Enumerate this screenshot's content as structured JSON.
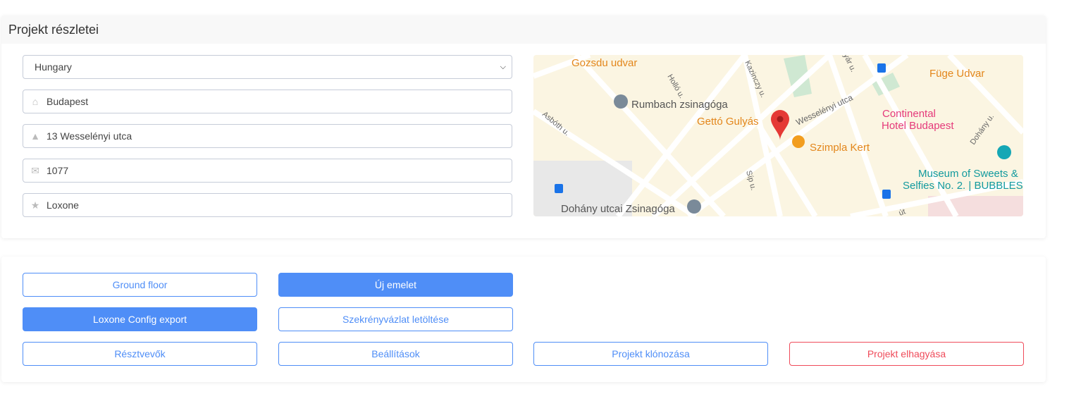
{
  "details": {
    "title": "Projekt részletei",
    "country": "Hungary",
    "city": "Budapest",
    "street": "13 Wesselényi utca",
    "zip": "1077",
    "brand": "Loxone",
    "icons": [
      "home-icon",
      "road-icon",
      "envelope-icon",
      "star-icon"
    ]
  },
  "map": {
    "labels": {
      "gozsdu": "Gozsdu udvar",
      "hollo": "Holló u.",
      "kazinczy": "Kazinczy u.",
      "fuge": "Füge Udvar",
      "rumbach": "Rumbach zsinagóga",
      "getto": "Gettó Gulyás",
      "wesselenyi": "Wesselényi utca",
      "continental1": "Continental",
      "continental2": "Hotel Budapest",
      "asboth": "Asbóth u.",
      "szimpla": "Szimpla Kert",
      "dohanyu": "Dohány u.",
      "museum1": "Museum of Sweets &",
      "museum2": "Selfies No. 2. | BUBBLES",
      "sip": "Síp u.",
      "dohanyzs": "Dohány utcai Zsinagóga",
      "ut": "út",
      "gyar": "yár u."
    }
  },
  "actions": {
    "ground_floor": "Ground floor",
    "new_floor": "Új emelet",
    "loxone_export": "Loxone Config export",
    "cabinet_download": "Szekrényvázlat letöltése",
    "participants": "Résztvevők",
    "settings": "Beállítások",
    "clone": "Projekt klónozása",
    "leave": "Projekt elhagyása"
  },
  "colors": {
    "primary": "#4f8ef7",
    "danger": "#ef4b5a"
  }
}
